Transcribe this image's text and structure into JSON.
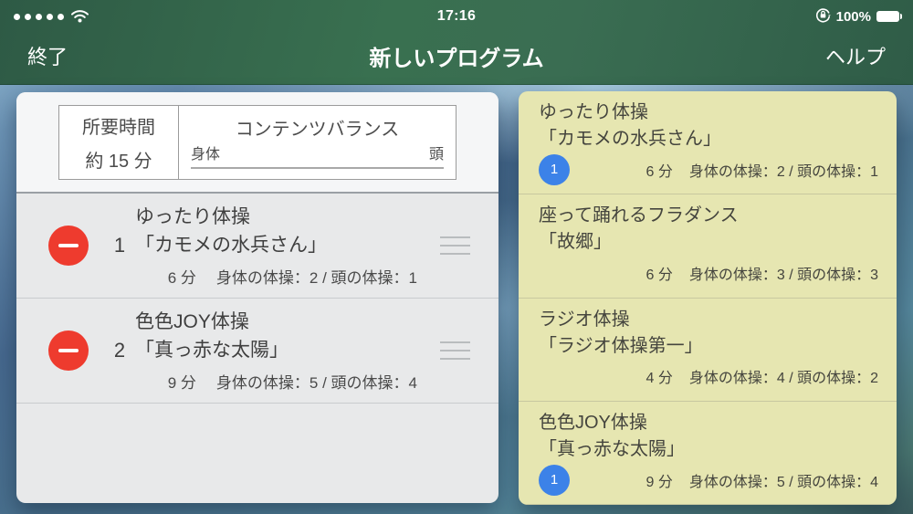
{
  "colors": {
    "nav_green": "#38684e",
    "delete_red": "#ee3b2e",
    "badge_blue": "#3c82e8",
    "balance_body_orange": "#f5a033",
    "balance_head_blue": "#3f51cc",
    "panel_left_bg": "#e8e9ea",
    "panel_right_bg": "#e6e6b1"
  },
  "status_bar": {
    "signal_dots": 5,
    "icons": {
      "wifi": "wifi-icon",
      "rotation_lock": "orientation-lock-icon",
      "battery": "battery-full-icon"
    },
    "time": "17:16",
    "battery_percent": "100%"
  },
  "nav_bar": {
    "left_button": "終了",
    "title": "新しいプログラム",
    "right_button": "ヘルプ"
  },
  "summary": {
    "duration_label": "所要時間",
    "duration_value": "約 15 分",
    "balance_title": "コンテンツバランス",
    "balance_left_label": "身体",
    "balance_right_label": "頭",
    "balance_bar": {
      "body_start_pct": 15.4,
      "body_width_pct": 34.2,
      "head_start_pct": 50.2,
      "head_width_pct": 24.3
    }
  },
  "program_list": {
    "items": [
      {
        "order": "1",
        "title": "ゆったり体操",
        "subtitle": "「カモメの水兵さん」",
        "duration": "6 分",
        "detail": "身体の体操：2 / 頭の体操：1"
      },
      {
        "order": "2",
        "title": "色色JOY体操",
        "subtitle": "「真っ赤な太陽」",
        "duration": "9 分",
        "detail": "身体の体操：5 / 頭の体操：4"
      }
    ]
  },
  "catalog_list": {
    "items": [
      {
        "title": "ゆったり体操",
        "subtitle": "「カモメの水兵さん」",
        "badge": "1",
        "duration": "6 分",
        "detail": "身体の体操：2 / 頭の体操：1"
      },
      {
        "title": "座って踊れるフラダンス",
        "subtitle": "「故郷」",
        "badge": null,
        "duration": "6 分",
        "detail": "身体の体操：3 / 頭の体操：3"
      },
      {
        "title": "ラジオ体操",
        "subtitle": "「ラジオ体操第一」",
        "badge": null,
        "duration": "4 分",
        "detail": "身体の体操：4 / 頭の体操：2"
      },
      {
        "title": "色色JOY体操",
        "subtitle": "「真っ赤な太陽」",
        "badge": "1",
        "duration": "9 分",
        "detail": "身体の体操：5 / 頭の体操：4"
      }
    ]
  }
}
